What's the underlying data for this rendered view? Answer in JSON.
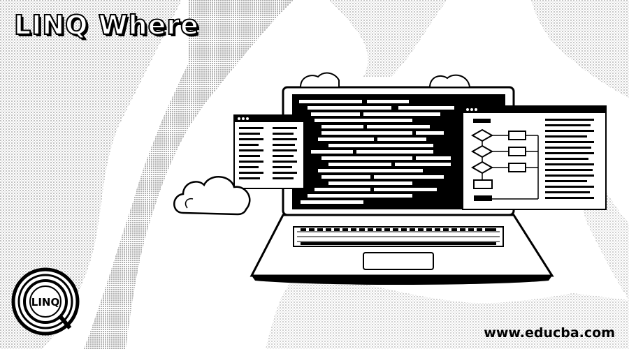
{
  "title": "LINQ Where",
  "logo": {
    "text": "LINQ"
  },
  "footer": {
    "site": "www.educba.com"
  },
  "colors": {
    "ink": "#000000",
    "paper": "#ffffff",
    "halftone": "#9a9a9a"
  },
  "icons": [
    "linq-logo-icon",
    "laptop-illustration",
    "cloud-icon",
    "flowchart-icon",
    "code-editor-illustration"
  ]
}
